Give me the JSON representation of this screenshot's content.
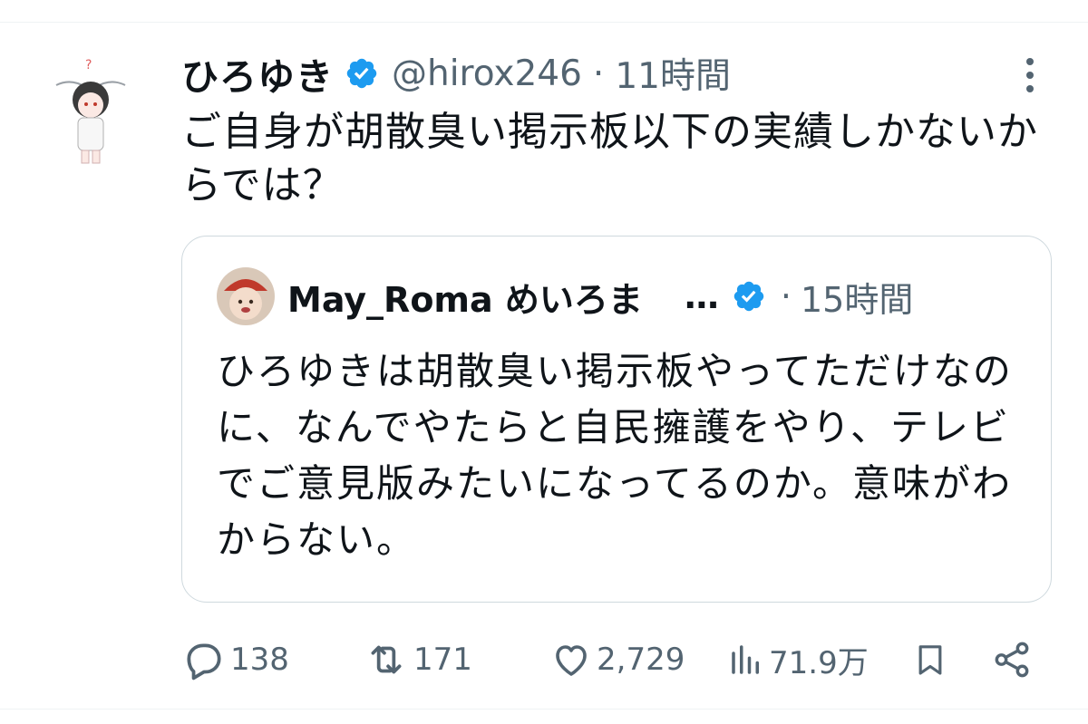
{
  "tweet": {
    "author_name": "ひろゆき",
    "handle": "@hirox246",
    "separator": "·",
    "time": "11時間",
    "text": "ご自身が胡散臭い掲示板以下の実績しかないからでは？"
  },
  "quoted": {
    "author_name": "May_Roma めいろま",
    "ellipsis": "…",
    "separator": "·",
    "time": "15時間",
    "text": "ひろゆきは胡散臭い掲示板やってただけなのに、なんでやたらと自民擁護をやり、テレビでご意見版みたいになってるのか。意味がわからない。"
  },
  "actions": {
    "replies": "138",
    "retweets": "171",
    "likes": "2,729",
    "views": "71.9万"
  },
  "colors": {
    "text": "#0f1419",
    "secondary": "#536471",
    "verified": "#1d9bf0",
    "border": "#cfd9de"
  },
  "icons": [
    "more-icon",
    "verified-icon",
    "reply-icon",
    "retweet-icon",
    "like-icon",
    "views-icon",
    "bookmark-icon",
    "share-icon"
  ]
}
